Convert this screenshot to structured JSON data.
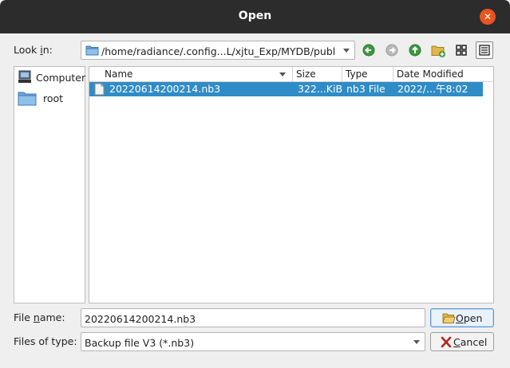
{
  "window": {
    "title": "Open"
  },
  "look_in": {
    "label_pre": "Look ",
    "label_mn": "i",
    "label_post": "n:",
    "path": "/home/radiance/.config...L/xjtu_Exp/MYDB/public"
  },
  "toolbar": {
    "back_icon": "back-arrow-icon",
    "forward_icon": "forward-arrow-icon",
    "parent_icon": "up-arrow-icon",
    "new_folder_icon": "new-folder-icon",
    "icon_view_icon": "grid-view-icon",
    "detail_view_icon": "detail-view-icon"
  },
  "sidebar": {
    "items": [
      {
        "label": "Computer",
        "icon": "computer-icon"
      },
      {
        "label": "root",
        "icon": "folder-icon"
      }
    ]
  },
  "file_list": {
    "columns": [
      "Name",
      "Size",
      "Type",
      "Date Modified"
    ],
    "rows": [
      {
        "name": "20220614200214.nb3",
        "size": "322...KiB",
        "type": "nb3 File",
        "date": "2022/...午8:02",
        "selected": true
      }
    ]
  },
  "file_name": {
    "label_pre": "File ",
    "label_mn": "n",
    "label_post": "ame:",
    "value": "20220614200214.nb3"
  },
  "file_type": {
    "label": "Files of type:",
    "value": "Backup file V3 (*.nb3)"
  },
  "buttons": {
    "open_mn": "O",
    "open_rest": "pen",
    "cancel_mn": "C",
    "cancel_rest": "ancel"
  },
  "colors": {
    "titlebar": "#2c2c2c",
    "close": "#e95420",
    "selection": "#308cc6",
    "nav_green": "#3c9a3c"
  }
}
